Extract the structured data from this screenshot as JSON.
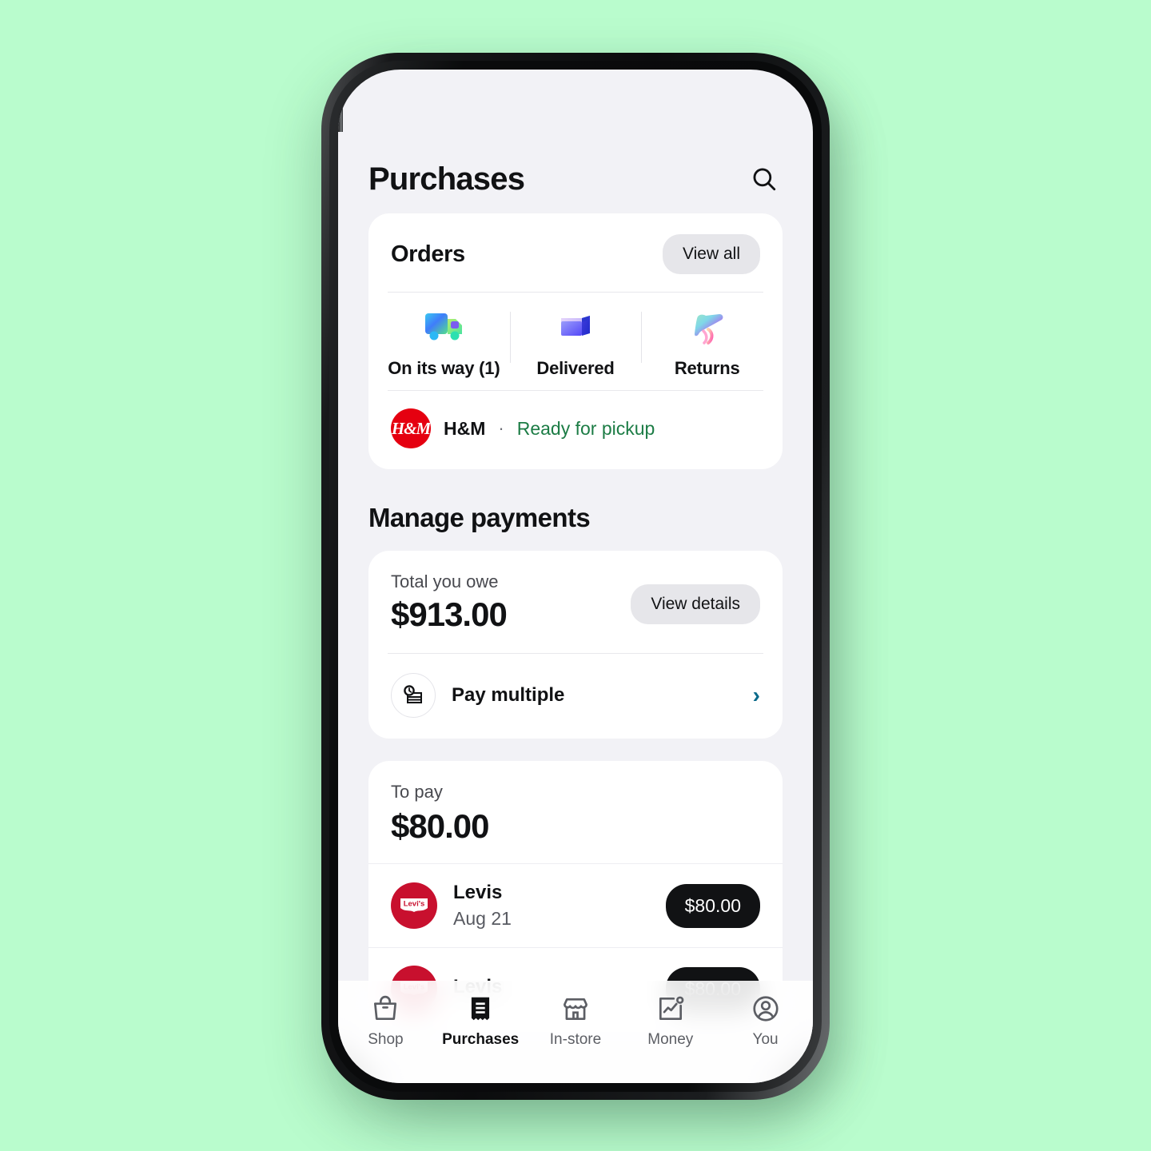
{
  "theme": {
    "page_background": "#b9fccd",
    "app_background": "#f2f2f6",
    "card_background": "#ffffff",
    "accent_green": "#1c7c45",
    "accent_blue": "#0a6a8a",
    "chip_dark": "#111214",
    "hm_red": "#e50010",
    "levis_red": "#c8102e"
  },
  "status_bar": {
    "signal_icon": "signal-icon",
    "wifi_icon": "wifi-icon",
    "battery_icon": "battery-icon"
  },
  "header": {
    "title": "Purchases",
    "search_icon": "search-icon"
  },
  "orders_card": {
    "title": "Orders",
    "view_all_label": "View all",
    "tabs": [
      {
        "label": "On its way (1)",
        "icon": "delivery-truck-icon"
      },
      {
        "label": "Delivered",
        "icon": "open-box-icon"
      },
      {
        "label": "Returns",
        "icon": "return-boomerang-icon"
      }
    ],
    "merchant": {
      "logo": "hm-logo",
      "logo_text": "H&M",
      "name": "H&M",
      "separator": "·",
      "status": "Ready for pickup"
    }
  },
  "manage_payments": {
    "section_title": "Manage payments",
    "total_owe": {
      "label": "Total you owe",
      "amount": "$913.00",
      "view_details_label": "View details"
    },
    "pay_multiple": {
      "icon": "pay-multiple-icon",
      "label": "Pay multiple",
      "chevron": "›"
    }
  },
  "to_pay": {
    "label": "To pay",
    "amount": "$80.00",
    "rows": [
      {
        "logo": "levis-logo",
        "logo_text": "Levi's",
        "name": "Levis",
        "date": "Aug 21",
        "amount": "$80.00"
      },
      {
        "logo": "levis-logo",
        "logo_text": "Levi's",
        "name": "Levis",
        "date": "",
        "amount": "$80.00"
      }
    ]
  },
  "bottom_nav": {
    "items": [
      {
        "label": "Shop",
        "icon": "shopping-bag-icon",
        "active": false
      },
      {
        "label": "Purchases",
        "icon": "receipt-icon",
        "active": true
      },
      {
        "label": "In-store",
        "icon": "storefront-icon",
        "active": false
      },
      {
        "label": "Money",
        "icon": "chart-money-icon",
        "active": false
      },
      {
        "label": "You",
        "icon": "person-icon",
        "active": false
      }
    ]
  }
}
